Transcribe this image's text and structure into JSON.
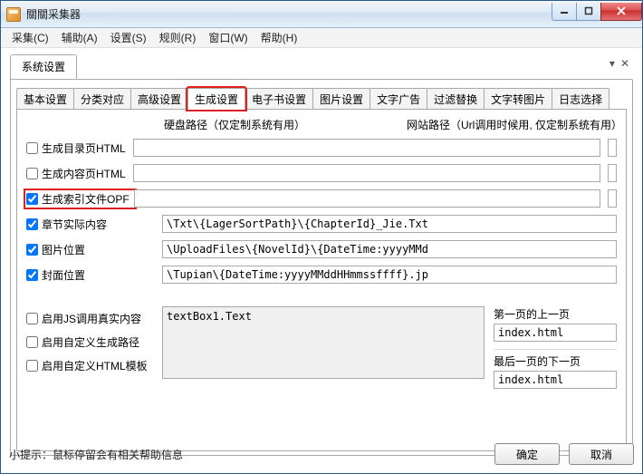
{
  "window": {
    "title": "關關采集器"
  },
  "menu": {
    "items": [
      "采集(C)",
      "辅助(A)",
      "设置(S)",
      "规则(R)",
      "窗口(W)",
      "帮助(H)"
    ]
  },
  "outer_tab": {
    "label": "系统设置"
  },
  "inner_tabs": {
    "items": [
      "基本设置",
      "分类对应",
      "高级设置",
      "生成设置",
      "电子书设置",
      "图片设置",
      "文字广告",
      "过滤替换",
      "文字转图片",
      "日志选择"
    ],
    "active_index": 3
  },
  "headers": {
    "disk_path": "硬盘路径（仅定制系统有用）",
    "web_path": "网站路径（Url调用时候用, 仅定制系统有用）"
  },
  "rows": [
    {
      "label": "生成目录页HTML",
      "checked": false,
      "disk": "",
      "web": "",
      "split": true
    },
    {
      "label": "生成内容页HTML",
      "checked": false,
      "disk": "",
      "web": "",
      "split": true
    },
    {
      "label": "生成索引文件OPF",
      "checked": true,
      "disk": "",
      "web": "",
      "split": true,
      "label_highlight": true
    },
    {
      "label": "章节实际内容",
      "checked": true,
      "value": "\\Txt\\{LagerSortPath}\\{ChapterId}_Jie.Txt",
      "split": false
    },
    {
      "label": "图片位置",
      "checked": true,
      "value": "\\UploadFiles\\{NovelId}\\{DateTime:yyyyMMd",
      "split": false
    },
    {
      "label": "封面位置",
      "checked": true,
      "value": "\\Tupian\\{DateTime:yyyyMMddHHmmssffff}.jp",
      "split": false
    }
  ],
  "lower": {
    "checks": [
      {
        "label": "启用JS调用真实内容",
        "checked": false
      },
      {
        "label": "启用自定义生成路径",
        "checked": false
      },
      {
        "label": "启用自定义HTML模板",
        "checked": false
      }
    ],
    "textarea_value": "textBox1.Text",
    "first_prev_label": "第一页的上一页",
    "first_prev_value": "index.html",
    "last_next_label": "最后一页的下一页",
    "last_next_value": "index.html"
  },
  "footer": {
    "hint": "小提示：鼠标停留会有相关帮助信息",
    "ok": "确定",
    "cancel": "取消"
  }
}
